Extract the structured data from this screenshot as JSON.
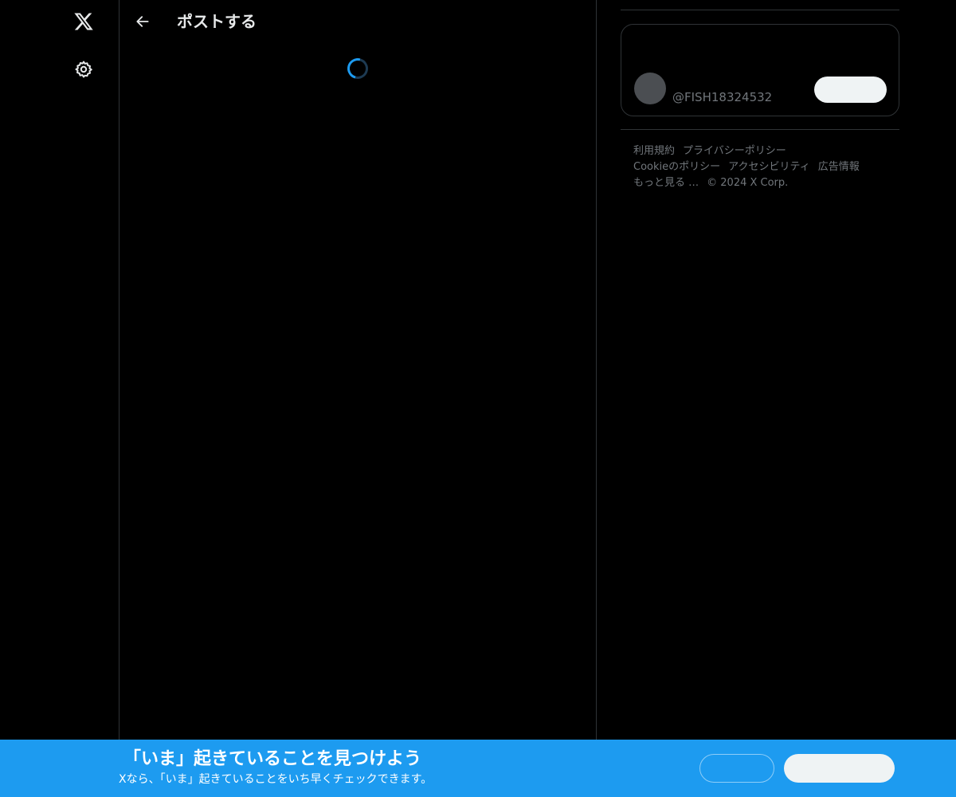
{
  "app": {
    "title": "X"
  },
  "nav": {
    "logo_icon": "x-logo-icon",
    "settings_icon": "gear-icon"
  },
  "header": {
    "back_icon": "arrow-left-icon",
    "title": "ポストする"
  },
  "sidebar_card": {
    "handle": "@FISH18324532",
    "follow_label": ""
  },
  "footer": {
    "links": [
      "利用規約",
      "プライバシーポリシー",
      "Cookieのポリシー",
      "アクセシビリティ",
      "広告情報",
      "もっと見る …"
    ],
    "copyright": "© 2024 X Corp."
  },
  "banner": {
    "title": "「いま」起きていることを見つけよう",
    "subtitle": "Xなら、「いま」起きていることをいち早くチェックできます。",
    "login_label": "",
    "signup_label": ""
  },
  "colors": {
    "accent": "#1d9bf0",
    "background": "#000000",
    "border": "#2f3336",
    "muted_text": "#71767b"
  }
}
